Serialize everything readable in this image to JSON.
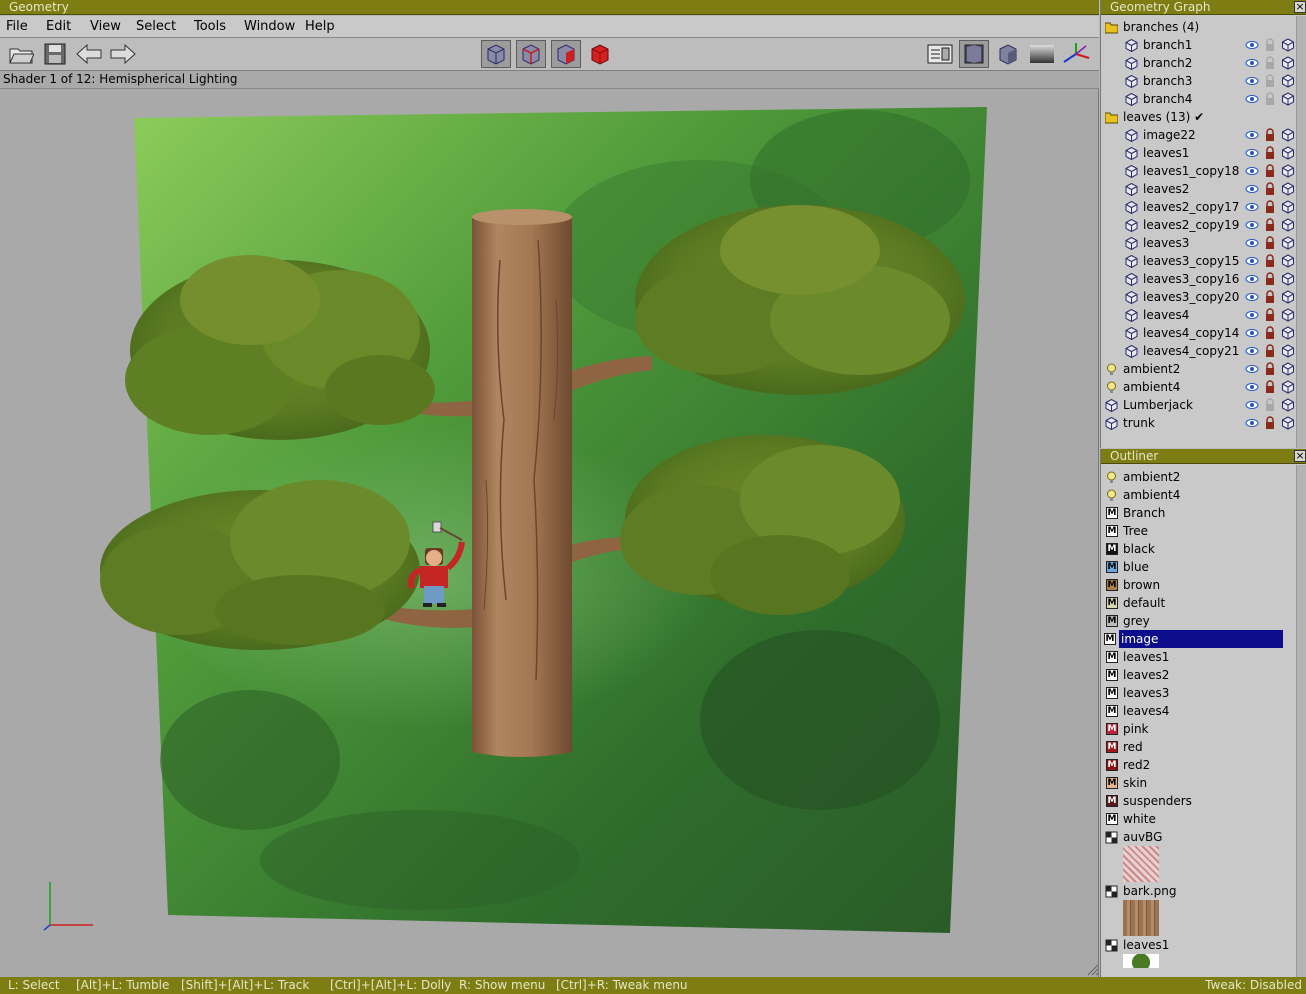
{
  "window": {
    "title": "Geometry"
  },
  "menu": [
    "File",
    "Edit",
    "View",
    "Select",
    "Tools",
    "Window",
    "Help"
  ],
  "toolbar": {
    "left": [
      "open-folder-icon",
      "save-icon",
      "undo-arrow-icon",
      "redo-arrow-icon"
    ],
    "center": [
      "wireframe-cube-icon",
      "wireframe-red-edge-cube-icon",
      "wireframe-red-face-cube-icon",
      "solid-red-cube-icon"
    ],
    "right": [
      "panel-list-icon",
      "sphere-shading-icon",
      "solid-cube-icon",
      "gradient-icon",
      "axes-icon"
    ]
  },
  "status": {
    "shader": "Shader 1 of 12: Hemispherical Lighting"
  },
  "geometry_graph": {
    "title": "Geometry Graph",
    "rows": [
      {
        "label": "branches (4)",
        "type": "folder",
        "indent": 0
      },
      {
        "label": "branch1",
        "type": "mesh",
        "indent": 1,
        "icons": true,
        "locked": false
      },
      {
        "label": "branch2",
        "type": "mesh",
        "indent": 1,
        "icons": true,
        "locked": false
      },
      {
        "label": "branch3",
        "type": "mesh",
        "indent": 1,
        "icons": true,
        "locked": false
      },
      {
        "label": "branch4",
        "type": "mesh",
        "indent": 1,
        "icons": true,
        "locked": false
      },
      {
        "label": "leaves (13) ✔",
        "type": "folder",
        "indent": 0
      },
      {
        "label": "image22",
        "type": "mesh",
        "indent": 1,
        "icons": true,
        "locked": true
      },
      {
        "label": "leaves1",
        "type": "mesh",
        "indent": 1,
        "icons": true,
        "locked": true
      },
      {
        "label": "leaves1_copy18",
        "type": "mesh",
        "indent": 1,
        "icons": true,
        "locked": true
      },
      {
        "label": "leaves2",
        "type": "mesh",
        "indent": 1,
        "icons": true,
        "locked": true
      },
      {
        "label": "leaves2_copy17",
        "type": "mesh",
        "indent": 1,
        "icons": true,
        "locked": true
      },
      {
        "label": "leaves2_copy19",
        "type": "mesh",
        "indent": 1,
        "icons": true,
        "locked": true
      },
      {
        "label": "leaves3",
        "type": "mesh",
        "indent": 1,
        "icons": true,
        "locked": true
      },
      {
        "label": "leaves3_copy15",
        "type": "mesh",
        "indent": 1,
        "icons": true,
        "locked": true
      },
      {
        "label": "leaves3_copy16",
        "type": "mesh",
        "indent": 1,
        "icons": true,
        "locked": true
      },
      {
        "label": "leaves3_copy20",
        "type": "mesh",
        "indent": 1,
        "icons": true,
        "locked": true
      },
      {
        "label": "leaves4",
        "type": "mesh",
        "indent": 1,
        "icons": true,
        "locked": true
      },
      {
        "label": "leaves4_copy14",
        "type": "mesh",
        "indent": 1,
        "icons": true,
        "locked": true
      },
      {
        "label": "leaves4_copy21",
        "type": "mesh",
        "indent": 1,
        "icons": true,
        "locked": true
      },
      {
        "label": "ambient2",
        "type": "light",
        "indent": 0,
        "icons": true,
        "locked": true
      },
      {
        "label": "ambient4",
        "type": "light",
        "indent": 0,
        "icons": true,
        "locked": true
      },
      {
        "label": "Lumberjack",
        "type": "mesh",
        "indent": 0,
        "icons": true,
        "locked": false
      },
      {
        "label": "trunk",
        "type": "mesh",
        "indent": 0,
        "icons": true,
        "locked": true
      }
    ]
  },
  "outliner": {
    "title": "Outliner",
    "rows": [
      {
        "label": "ambient2",
        "type": "light"
      },
      {
        "label": "ambient4",
        "type": "light"
      },
      {
        "label": "Branch",
        "type": "material",
        "color": "#ffffff"
      },
      {
        "label": "Tree",
        "type": "material",
        "color": "#ffffff"
      },
      {
        "label": "black",
        "type": "material",
        "color": "#111111",
        "dark": true
      },
      {
        "label": "blue",
        "type": "material",
        "color": "#6ea6de"
      },
      {
        "label": "brown",
        "type": "material",
        "color": "#b0804a"
      },
      {
        "label": "default",
        "type": "material",
        "color": "#d8d8b0"
      },
      {
        "label": "grey",
        "type": "material",
        "color": "#bcbcbc"
      },
      {
        "label": "image",
        "type": "material",
        "color": "#ffffff",
        "selected": true
      },
      {
        "label": "leaves1",
        "type": "material",
        "color": "#ffffff"
      },
      {
        "label": "leaves2",
        "type": "material",
        "color": "#ffffff"
      },
      {
        "label": "leaves3",
        "type": "material",
        "color": "#ffffff"
      },
      {
        "label": "leaves4",
        "type": "material",
        "color": "#ffffff"
      },
      {
        "label": "pink",
        "type": "material",
        "color": "#c0253a",
        "dark": true
      },
      {
        "label": "red",
        "type": "material",
        "color": "#a01818",
        "dark": true
      },
      {
        "label": "red2",
        "type": "material",
        "color": "#8c1414",
        "dark": true
      },
      {
        "label": "skin",
        "type": "material",
        "color": "#e8b48a"
      },
      {
        "label": "suspenders",
        "type": "material",
        "color": "#5a1a1a",
        "dark": true
      },
      {
        "label": "white",
        "type": "material",
        "color": "#ffffff"
      },
      {
        "label": "auvBG",
        "type": "texture"
      },
      {
        "label": "bark.png",
        "type": "texture"
      },
      {
        "label": "leaves1",
        "type": "texture"
      }
    ]
  },
  "hints": [
    "L: Select",
    "[Alt]+L: Tumble",
    "[Shift]+[Alt]+L: Track",
    "[Ctrl]+[Alt]+L: Dolly",
    "R: Show menu",
    "[Ctrl]+R: Tweak menu"
  ],
  "tweak": "Tweak: Disabled",
  "colors": {
    "titlebar": "#7d7d14",
    "selection": "#0d0d8c",
    "eye": "#2255cc",
    "lock": "#8a2a1a"
  }
}
